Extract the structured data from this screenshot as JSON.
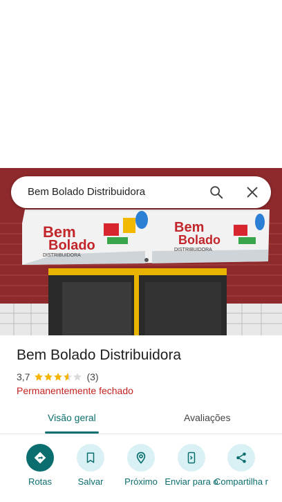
{
  "search": {
    "query": "Bem Bolado Distribuidora"
  },
  "photo": {
    "sign_brand": "Bem Bolado",
    "sign_subtitle": "DISTRIBUIDORA"
  },
  "place": {
    "name": "Bem Bolado Distribuidora",
    "rating": "3,7",
    "rating_value": 3.7,
    "review_count": "(3)",
    "status": "Permanentemente fechado"
  },
  "tabs": [
    {
      "label": "Visão geral",
      "active": true
    },
    {
      "label": "Avaliações",
      "active": false
    }
  ],
  "actions": [
    {
      "label": "Rotas",
      "icon": "directions-icon"
    },
    {
      "label": "Salvar",
      "icon": "bookmark-icon"
    },
    {
      "label": "Próximo",
      "icon": "nearby-icon"
    },
    {
      "label": "Enviar para o",
      "icon": "send-to-phone-icon"
    },
    {
      "label": "Compartilha r",
      "icon": "share-icon"
    }
  ],
  "colors": {
    "accent": "#0b6e6e",
    "status_closed": "#c5221f",
    "star": "#f4b400"
  }
}
